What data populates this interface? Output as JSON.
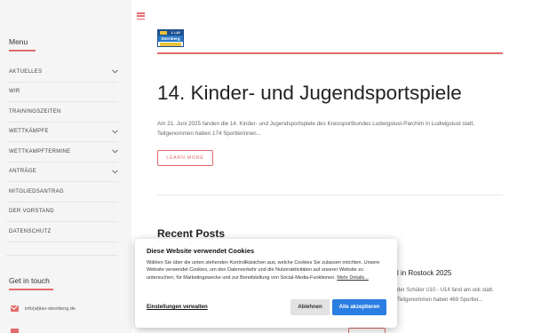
{
  "sidebar": {
    "menu_title": "Menu",
    "items": [
      {
        "label": "AKTUELLES",
        "has_submenu": true
      },
      {
        "label": "WIR",
        "has_submenu": false
      },
      {
        "label": "TRAININGSZEITEN",
        "has_submenu": false
      },
      {
        "label": "WETTKÄMPFE",
        "has_submenu": true
      },
      {
        "label": "WETTKAMPFTERMINE",
        "has_submenu": true
      },
      {
        "label": "ANTRÄGE",
        "has_submenu": true
      },
      {
        "label": "MITGLIEDSANTRAG",
        "has_submenu": false
      },
      {
        "label": "DER VORSTAND",
        "has_submenu": false
      },
      {
        "label": "DATENSCHUTZ",
        "has_submenu": false
      }
    ],
    "touch_title": "Get in touch",
    "email": "info(at)lav-sternberg.de"
  },
  "logo": {
    "top_text": "1. LAV",
    "name": "Sternberg"
  },
  "article": {
    "headline": "14. Kinder- und Jugendsportspiele",
    "excerpt": "Am 21. Juni 2025 fanden die 14. Kinder- und Jugendsportspiele des Kreissportbundes Ludwigslust-Parchim in Ludwigslust statt. Teilgenommen haben 174 Sportlerinnen...",
    "learn_more": "LEARN MORE"
  },
  "recent": {
    "title": "Recent Posts",
    "post_title": "l in Rostock 2025",
    "post_text": "der Schüler U10 - U14 fand am ock statt. Teilgenommen haben 469 Sportler..."
  },
  "cookie": {
    "title": "Diese Website verwendet Cookies",
    "text": "Wählen Sie über die unten stehenden Kontrollkästchen aus, welche Cookies Sie zulassen möchten. Unsere Website verwendet Cookies, um den Datenverkehr und die Nutzeraktivitäten auf unserer Website zu untersuchen, für Marketingzwecke und zur Bereitstellung von Social-Media-Funktionen.",
    "more_details": "Mehr Details...",
    "settings": "Einstellungen verwalten",
    "decline": "Ablehnen",
    "accept": "Alle akzeptieren"
  },
  "colors": {
    "accent": "#e26a6a",
    "primary_button": "#2a7de1",
    "sidebar_bg": "#f5f5f5"
  }
}
